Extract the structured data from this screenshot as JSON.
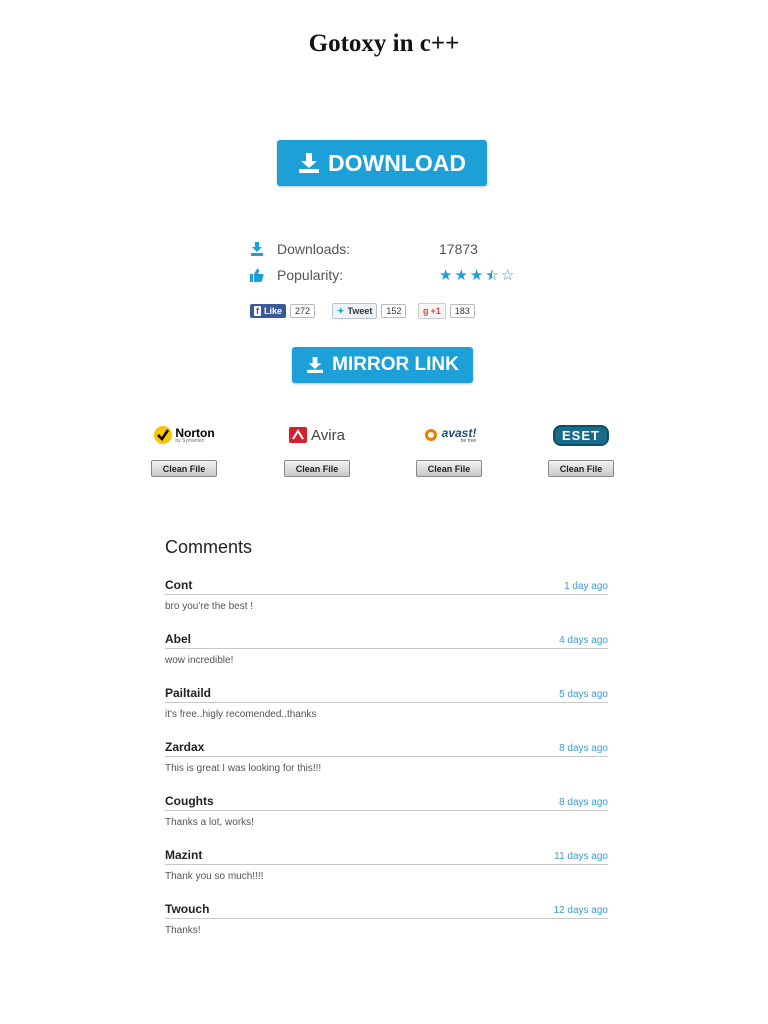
{
  "title": "Gotoxy in c++",
  "download_button": {
    "label": "DOWNLOAD"
  },
  "stats": {
    "downloads_label": "Downloads:",
    "downloads_value": "17873",
    "popularity_label": "Popularity:",
    "popularity_stars": 3.5,
    "popularity_max": 5
  },
  "social": {
    "facebook": {
      "label": "Like",
      "count": "272"
    },
    "twitter": {
      "label": "Tweet",
      "count": "152"
    },
    "google": {
      "label": "+1",
      "count": "183"
    }
  },
  "mirror_button": {
    "label": "MIRROR LINK"
  },
  "antivirus": [
    {
      "name": "Norton",
      "sub": "by Symantec",
      "button": "Clean File",
      "color": "#000000"
    },
    {
      "name": "Avira",
      "button": "Clean File",
      "color": "#d5202d"
    },
    {
      "name": "avast!",
      "sub": "be free",
      "button": "Clean File",
      "color": "#f07c00"
    },
    {
      "name": "eset",
      "button": "Clean File",
      "color": "#1a6b8a"
    }
  ],
  "comments": {
    "heading": "Comments",
    "items": [
      {
        "name": "Cont",
        "time": "1 day ago",
        "text": "bro you're the best !"
      },
      {
        "name": "Abel",
        "time": "4 days ago",
        "text": "wow incredible!"
      },
      {
        "name": "Pailtaild",
        "time": "5 days ago",
        "text": "it's free..higly recomended..thanks"
      },
      {
        "name": "Zardax",
        "time": "8 days ago",
        "text": "This is great I was looking for this!!!"
      },
      {
        "name": "Coughts",
        "time": "8 days ago",
        "text": "Thanks a lot, works!"
      },
      {
        "name": "Mazint",
        "time": "11 days ago",
        "text": "Thank you so much!!!!"
      },
      {
        "name": "Twouch",
        "time": "12 days ago",
        "text": "Thanks!"
      }
    ]
  },
  "colors": {
    "accent": "#1d9fd8",
    "link": "#3a9bd6"
  }
}
